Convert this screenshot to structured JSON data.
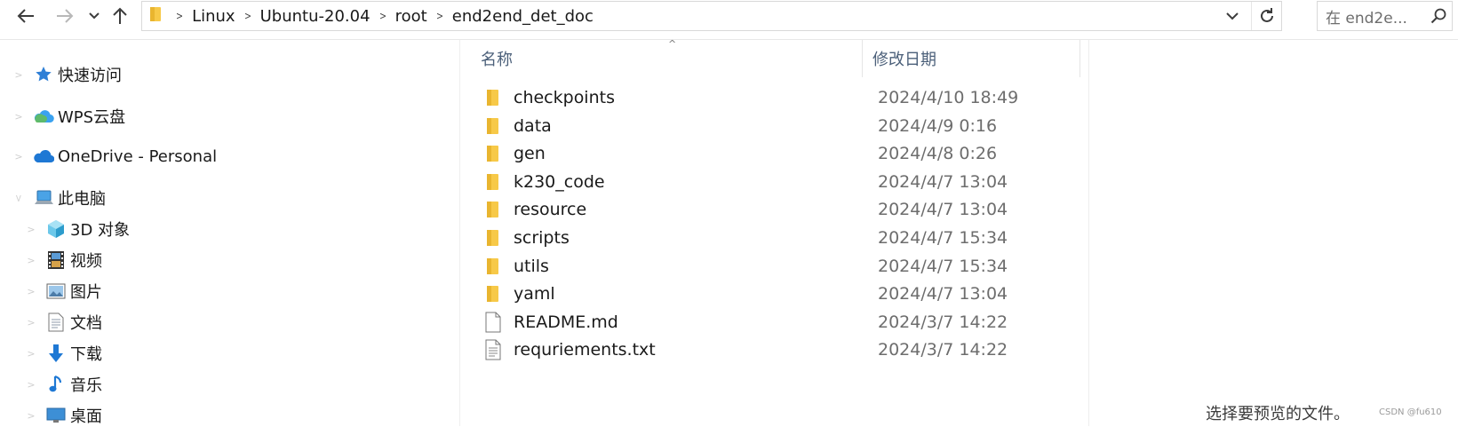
{
  "toolbar": {
    "back_icon": "arrow-left",
    "forward_icon": "arrow-right",
    "recent_icon": "chevron-down",
    "up_icon": "arrow-up"
  },
  "address": {
    "breadcrumbs": [
      "Linux",
      "Ubuntu-20.04",
      "root",
      "end2end_det_doc"
    ]
  },
  "search": {
    "placeholder": "在 end2e..."
  },
  "sidebar": {
    "items": [
      {
        "label": "快速访问",
        "icon": "star-icon"
      },
      {
        "label": "WPS云盘",
        "icon": "cloud-icon"
      },
      {
        "label": "OneDrive - Personal",
        "icon": "onedrive-icon"
      },
      {
        "label": "此电脑",
        "icon": "computer-icon"
      },
      {
        "label": "3D 对象",
        "icon": "cube-icon"
      },
      {
        "label": "视频",
        "icon": "film-icon"
      },
      {
        "label": "图片",
        "icon": "picture-icon"
      },
      {
        "label": "文档",
        "icon": "document-icon"
      },
      {
        "label": "下载",
        "icon": "download-icon"
      },
      {
        "label": "音乐",
        "icon": "music-icon"
      },
      {
        "label": "桌面",
        "icon": "desktop-icon"
      }
    ]
  },
  "columns": {
    "name": "名称",
    "modified": "修改日期"
  },
  "files": [
    {
      "name": "checkpoints",
      "modified": "2024/4/10 18:49",
      "type": "folder"
    },
    {
      "name": "data",
      "modified": "2024/4/9 0:16",
      "type": "folder"
    },
    {
      "name": "gen",
      "modified": "2024/4/8 0:26",
      "type": "folder"
    },
    {
      "name": "k230_code",
      "modified": "2024/4/7 13:04",
      "type": "folder"
    },
    {
      "name": "resource",
      "modified": "2024/4/7 13:04",
      "type": "folder"
    },
    {
      "name": "scripts",
      "modified": "2024/4/7 15:34",
      "type": "folder"
    },
    {
      "name": "utils",
      "modified": "2024/4/7 15:34",
      "type": "folder"
    },
    {
      "name": "yaml",
      "modified": "2024/4/7 13:04",
      "type": "folder"
    },
    {
      "name": "README.md",
      "modified": "2024/3/7 14:22",
      "type": "file"
    },
    {
      "name": "requriements.txt",
      "modified": "2024/3/7 14:22",
      "type": "text-file"
    }
  ],
  "preview": {
    "message": "选择要预览的文件。"
  },
  "watermark": "CSDN @fu610",
  "colors": {
    "folder": "#f7c948",
    "accent_blue": "#1e78d4",
    "header_text": "#4c607a",
    "date_text": "#6d6d6d"
  }
}
